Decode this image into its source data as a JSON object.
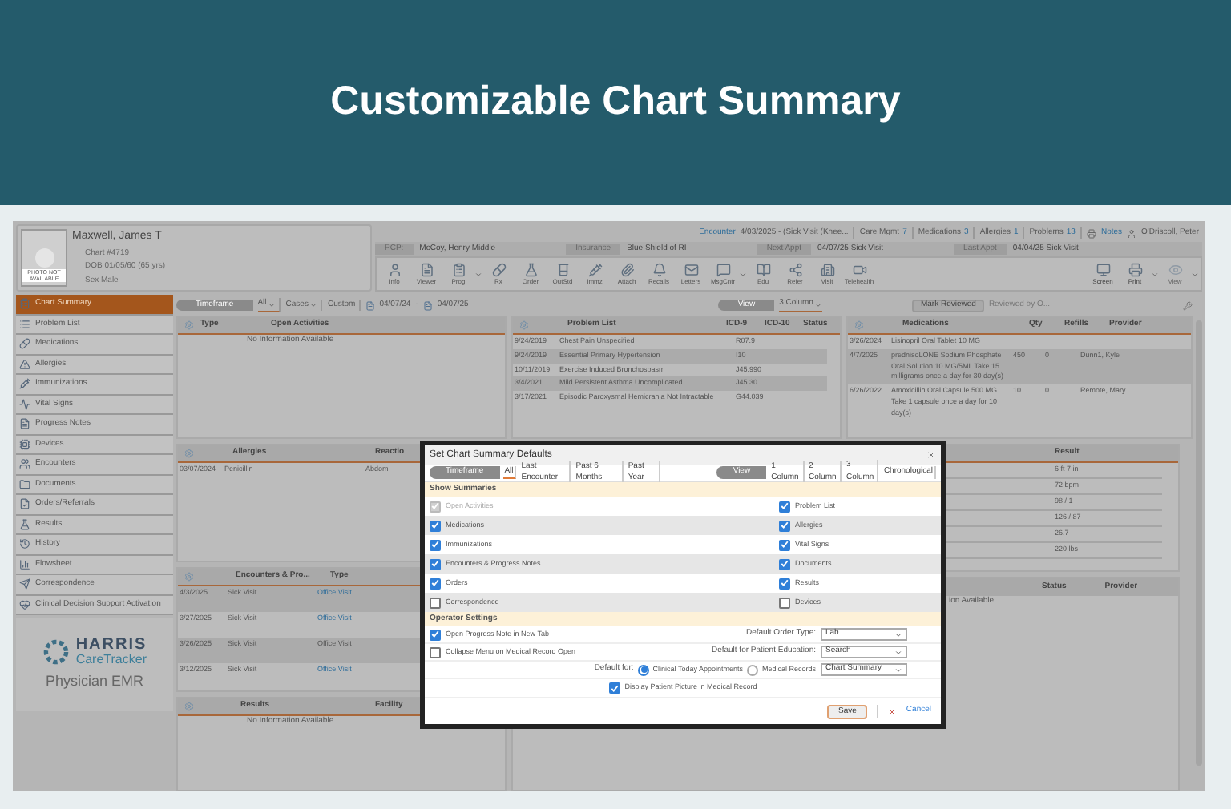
{
  "banner": {
    "title": "Customizable Chart Summary"
  },
  "patient": {
    "photo_label": "PHOTO NOT AVAILABLE",
    "name": "Maxwell, James T",
    "lines": [
      "Chart #4719",
      "DOB 01/05/60 (65 yrs)",
      "Sex Male"
    ]
  },
  "encounter_bar": {
    "encounter_link": "Encounter",
    "encounter_text": "4/03/2025 - (Sick Visit (Knee...",
    "counts": [
      {
        "label": "Care Mgmt",
        "count": "7"
      },
      {
        "label": "Medications",
        "count": "3"
      },
      {
        "label": "Allergies",
        "count": "1"
      },
      {
        "label": "Problems",
        "count": "13"
      }
    ],
    "notes": "Notes",
    "provider": "O'Driscoll, Peter"
  },
  "info_bar": [
    {
      "label": "PCP:",
      "value": "McCoy, Henry Middle"
    },
    {
      "label": "Insurance",
      "value": "Blue Shield of RI"
    },
    {
      "label": "Next Appt",
      "value": "04/07/25 Sick Visit"
    },
    {
      "label": "Last Appt",
      "value": "04/04/25 Sick Visit"
    }
  ],
  "toolbar": [
    {
      "label": "Info",
      "dropdown": false
    },
    {
      "label": "Viewer",
      "dropdown": false
    },
    {
      "label": "Prog",
      "dropdown": true
    },
    {
      "label": "Rx",
      "dropdown": false
    },
    {
      "label": "Order",
      "dropdown": false
    },
    {
      "label": "OutStd",
      "dropdown": false
    },
    {
      "label": "Immz",
      "dropdown": false
    },
    {
      "label": "Attach",
      "dropdown": false
    },
    {
      "label": "Recalls",
      "dropdown": false
    },
    {
      "label": "Letters",
      "dropdown": false
    },
    {
      "label": "MsgCntr",
      "dropdown": true
    },
    {
      "label": "Edu",
      "dropdown": false
    },
    {
      "label": "Refer",
      "dropdown": false
    },
    {
      "label": "Visit",
      "dropdown": false
    },
    {
      "label": "Telehealth",
      "dropdown": false
    }
  ],
  "toolbar_right": [
    {
      "label": "Screen",
      "dropdown": false,
      "disabled": false
    },
    {
      "label": "Print",
      "dropdown": true,
      "disabled": false
    },
    {
      "label": "View",
      "dropdown": true,
      "disabled": true
    }
  ],
  "sidebar": {
    "items": [
      {
        "label": "Chart Summary",
        "selected": true
      },
      {
        "label": "Problem List",
        "selected": false
      },
      {
        "label": "Medications",
        "selected": false
      },
      {
        "label": "Allergies",
        "selected": false
      },
      {
        "label": "Immunizations",
        "selected": false
      },
      {
        "label": "Vital Signs",
        "selected": false
      },
      {
        "label": "Progress Notes",
        "selected": false
      },
      {
        "label": "Devices",
        "selected": false
      },
      {
        "label": "Encounters",
        "selected": false
      },
      {
        "label": "Documents",
        "selected": false
      },
      {
        "label": "Orders/Referrals",
        "selected": false
      },
      {
        "label": "Results",
        "selected": false
      },
      {
        "label": "History",
        "selected": false
      },
      {
        "label": "Flowsheet",
        "selected": false
      },
      {
        "label": "Correspondence",
        "selected": false
      },
      {
        "label": "Clinical Decision Support Activation",
        "selected": false
      }
    ]
  },
  "logo": {
    "brand": "HARRIS",
    "product": "CareTracker",
    "edition": "Physician EMR"
  },
  "filter_bar": {
    "timeframe_pill": "Timeframe",
    "filters": [
      {
        "label": "All",
        "selected": true,
        "dropdown": true
      },
      {
        "label": "Cases",
        "selected": false,
        "dropdown": true
      },
      {
        "label": "Custom",
        "selected": false,
        "dropdown": false
      }
    ],
    "date_from": "04/07/24",
    "separator": "-",
    "date_to": "04/07/25",
    "view_pill": "View",
    "view_value": "3 Column",
    "mark_reviewed": "Mark Reviewed",
    "reviewed_by": "Reviewed by O..."
  },
  "open_activities": {
    "columns": [
      "Type",
      "Open Activities"
    ],
    "empty": "No Information Available"
  },
  "problem_list": {
    "columns": [
      "Problem List",
      "ICD-9",
      "ICD-10",
      "Status"
    ],
    "rows": [
      {
        "date": "9/24/2019",
        "problem": "Chest Pain Unspecified",
        "icd10": "R07.9"
      },
      {
        "date": "9/24/2019",
        "problem": "Essential Primary Hypertension",
        "icd10": "I10"
      },
      {
        "date": "10/11/2019",
        "problem": "Exercise Induced Bronchospasm",
        "icd10": "J45.990"
      },
      {
        "date": "3/4/2021",
        "problem": "Mild Persistent Asthma Uncomplicated",
        "icd10": "J45.30"
      },
      {
        "date": "3/17/2021",
        "problem": "Episodic Paroxysmal Hemicrania Not Intractable",
        "icd10": "G44.039"
      }
    ]
  },
  "medications": {
    "columns": [
      "Medications",
      "Qty",
      "Refills",
      "Provider"
    ],
    "rows": [
      {
        "date": "3/26/2024",
        "drug": "Lisinopril Oral Tablet 10 MG"
      },
      {
        "date": "4/7/2025",
        "drug": "prednisoLONE Sodium Phosphate Oral Solution 10 MG/5ML Take 15 milligrams once a day for 30 day(s)",
        "qty": "450",
        "refills": "0",
        "provider": "Dunn1, Kyle"
      },
      {
        "date": "6/26/2022",
        "drug": "Amoxicillin Oral Capsule 500 MG Take 1 capsule once a day for 10 day(s)",
        "qty": "10",
        "refills": "0",
        "provider": "Remote, Mary"
      }
    ]
  },
  "allergies": {
    "columns": [
      "Allergies",
      "Reactio"
    ],
    "rows": [
      {
        "date": "03/07/2024",
        "allergen": "Penicillin",
        "reaction": "Abdom"
      }
    ]
  },
  "encounters": {
    "columns": [
      "Encounters & Pro...",
      "Type"
    ],
    "rows": [
      {
        "date": "4/3/2025",
        "visit": "Sick Visit",
        "type": "Office Visit",
        "link": true
      },
      {
        "date": "3/27/2025",
        "visit": "Sick Visit",
        "type": "Office Visit",
        "link": true
      },
      {
        "date": "3/26/2025",
        "visit": "Sick Visit",
        "type": "Office Visit",
        "link": false
      },
      {
        "date": "3/12/2025",
        "visit": "Sick Visit",
        "type": "Office Visit",
        "link": true
      }
    ]
  },
  "results": {
    "columns": [
      "Results",
      "Facility"
    ],
    "empty": "No Information Available"
  },
  "vitals": {
    "column": "Result",
    "readings": [
      "6 ft 7 in",
      "72 bpm",
      "98 / 1",
      "126 / 87",
      "26.7",
      "220 lbs"
    ]
  },
  "orders": {
    "columns": [
      "Status",
      "Provider"
    ],
    "empty": "ion Available"
  },
  "dialog": {
    "title": "Set Chart Summary Defaults",
    "timeframe_pill": "Timeframe",
    "timeframes": [
      {
        "label": "All",
        "selected": true
      },
      {
        "label": "Last Encounter",
        "selected": false
      },
      {
        "label": "Past 6 Months",
        "selected": false
      },
      {
        "label": "Past Year",
        "selected": false
      }
    ],
    "view_pill": "View",
    "views": [
      {
        "label": "1 Column",
        "selected": false
      },
      {
        "label": "2 Column",
        "selected": false
      },
      {
        "label": "3 Column",
        "selected": true
      },
      {
        "label": "Chronological",
        "selected": false
      }
    ],
    "summaries_title": "Show Summaries",
    "summaries": [
      {
        "label": "Open Activities",
        "checked": true,
        "disabled": true
      },
      {
        "label": "Problem List",
        "checked": true,
        "disabled": false
      },
      {
        "label": "Medications",
        "checked": true,
        "disabled": false
      },
      {
        "label": "Allergies",
        "checked": true,
        "disabled": false
      },
      {
        "label": "Immunizations",
        "checked": true,
        "disabled": false
      },
      {
        "label": "Vital Signs",
        "checked": true,
        "disabled": false
      },
      {
        "label": "Encounters & Progress Notes",
        "checked": true,
        "disabled": false
      },
      {
        "label": "Documents",
        "checked": true,
        "disabled": false
      },
      {
        "label": "Orders",
        "checked": true,
        "disabled": false
      },
      {
        "label": "Results",
        "checked": true,
        "disabled": false
      },
      {
        "label": "Correspondence",
        "checked": false,
        "disabled": false
      },
      {
        "label": "Devices",
        "checked": false,
        "disabled": false
      }
    ],
    "operator_title": "Operator Settings",
    "open_note": {
      "label": "Open Progress Note in New Tab",
      "checked": true
    },
    "order_type": {
      "label": "Default Order Type:",
      "value": "Lab"
    },
    "collapse_menu": {
      "label": "Collapse Menu on Medical Record Open",
      "checked": false
    },
    "patient_education": {
      "label": "Default for Patient Education:",
      "value": "Search"
    },
    "default_for": {
      "label": "Default for:",
      "options": [
        {
          "label": "Clinical Today Appointments",
          "selected": true
        },
        {
          "label": "Medical Records",
          "selected": false
        }
      ],
      "value": "Chart Summary"
    },
    "display_picture": {
      "label": "Display Patient Picture in Medical Record",
      "checked": true
    },
    "save": "Save",
    "cancel": "Cancel"
  }
}
